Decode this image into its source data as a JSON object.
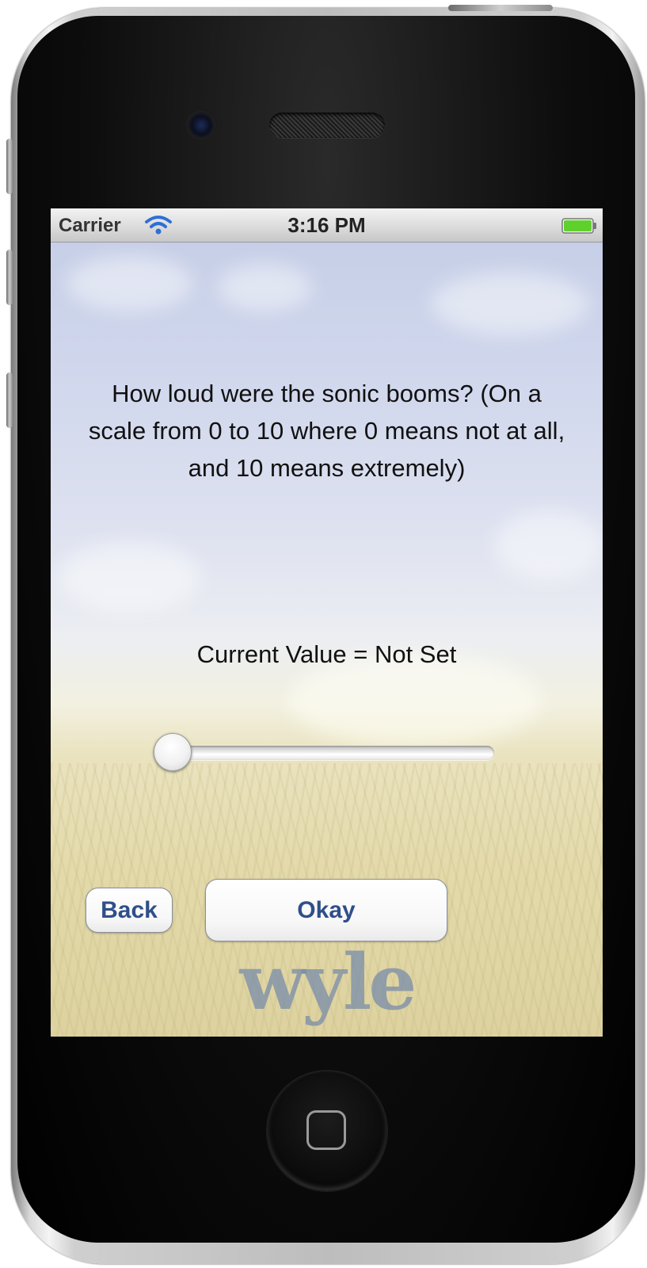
{
  "status_bar": {
    "carrier": "Carrier",
    "time": "3:16 PM",
    "icons": [
      "wifi-icon",
      "battery-icon"
    ]
  },
  "survey": {
    "question": "How loud were the sonic booms? (On a scale from 0 to 10 where 0 means not at all, and 10 means extremely)",
    "current_value_label": "Current Value = ",
    "current_value": "Not Set",
    "slider": {
      "min": 0,
      "max": 10,
      "position": 0
    }
  },
  "buttons": {
    "back_label": "Back",
    "okay_label": "Okay"
  },
  "branding": {
    "logo_text": "wyle"
  },
  "colors": {
    "button_text": "#2f4f8a",
    "battery": "#5fd12d",
    "wifi": "#2f6fd6"
  }
}
